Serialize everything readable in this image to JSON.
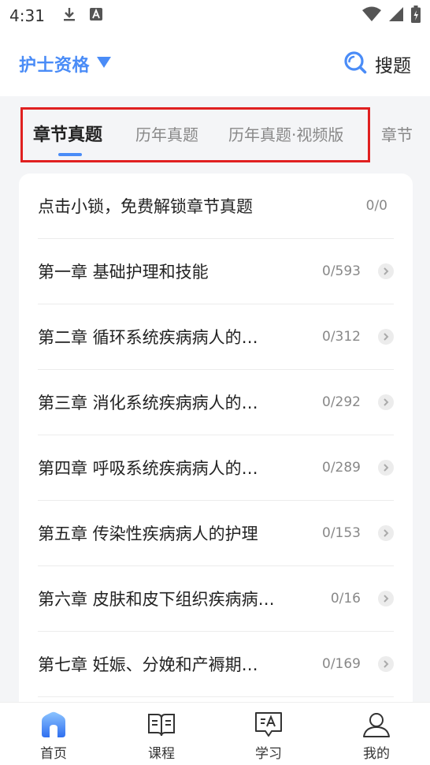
{
  "status_bar": {
    "time": "4:31"
  },
  "header": {
    "exam_name": "护士资格",
    "search_label": "搜题"
  },
  "tabs": [
    {
      "label": "章节真题",
      "active": true
    },
    {
      "label": "历年真题",
      "active": false
    },
    {
      "label": "历年真题·视频版",
      "active": false
    },
    {
      "label": "章节",
      "active": false
    }
  ],
  "chapters": [
    {
      "title": "点击小锁，免费解锁章节真题",
      "count": "0/0"
    },
    {
      "title": "第一章 基础护理和技能",
      "count": "0/593"
    },
    {
      "title": "第二章 循环系统疾病病人的…",
      "count": "0/312"
    },
    {
      "title": "第三章 消化系统疾病病人的…",
      "count": "0/292"
    },
    {
      "title": "第四章 呼吸系统疾病病人的…",
      "count": "0/289"
    },
    {
      "title": "第五章 传染性疾病病人的护理",
      "count": "0/153"
    },
    {
      "title": "第六章 皮肤和皮下组织疾病病…",
      "count": "0/16"
    },
    {
      "title": "第七章 妊娠、分娩和产褥期…",
      "count": "0/169"
    }
  ],
  "bottom_nav": [
    {
      "label": "首页",
      "icon": "home-icon",
      "active": true
    },
    {
      "label": "课程",
      "icon": "book-icon",
      "active": false
    },
    {
      "label": "学习",
      "icon": "study-icon",
      "active": false
    },
    {
      "label": "我的",
      "icon": "profile-icon",
      "active": false
    }
  ],
  "colors": {
    "accent": "#4a8cf7",
    "highlight_box": "#e02020",
    "background": "#f4f5f7"
  }
}
